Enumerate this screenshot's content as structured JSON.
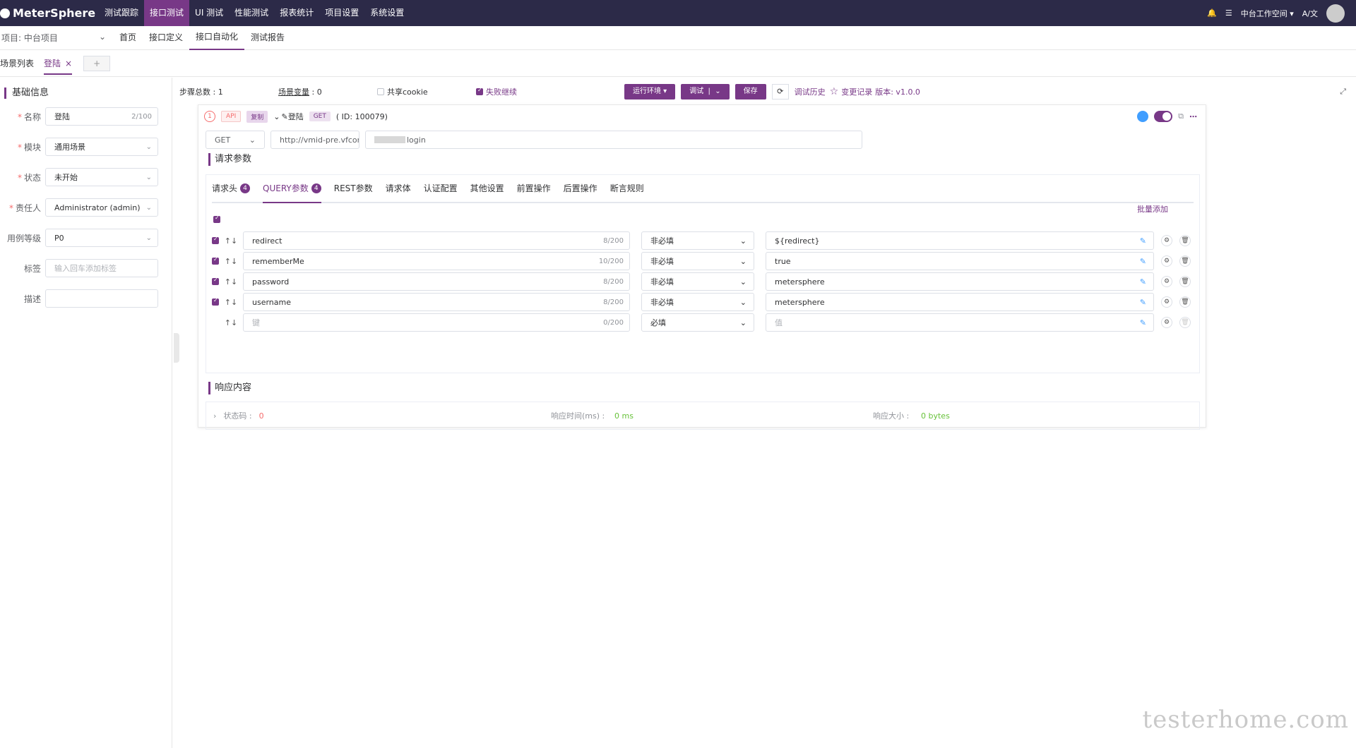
{
  "app": {
    "name": "MeterSphere"
  },
  "top_nav": {
    "items": [
      "测试跟踪",
      "接口测试",
      "UI 测试",
      "性能测试",
      "报表统计",
      "项目设置",
      "系统设置"
    ],
    "active": 1,
    "workspace": "中台工作空间",
    "lang": "A/文"
  },
  "sub_nav": {
    "project": "项目: 中台项目",
    "items": [
      "首页",
      "接口定义",
      "接口自动化",
      "测试报告"
    ],
    "active": 2
  },
  "tabs": {
    "list_label": "场景列表",
    "active_label": "登陆",
    "add_label": "+"
  },
  "basic_info": {
    "title": "基础信息",
    "name_label": "名称",
    "name_value": "登陆",
    "name_count": "2/100",
    "module_label": "模块",
    "module_value": "通用场景",
    "status_label": "状态",
    "status_value": "未开始",
    "owner_label": "责任人",
    "owner_value": "Administrator (admin)",
    "level_label": "用例等级",
    "level_value": "P0",
    "tag_label": "标签",
    "tag_placeholder": "输入回车添加标签",
    "desc_label": "描述"
  },
  "toolbar": {
    "steps_label": "步骤总数 : ",
    "steps_value": "1",
    "vars_label": "场景变量",
    "vars_value": " : 0",
    "share_cookie": "共享cookie",
    "fail_continue": "失败继续",
    "env_btn": "运行环境",
    "debug_btn": "调试",
    "save_btn": "保存",
    "history": "调试历史",
    "changes": "变更记录",
    "version": "版本: v1.0.0"
  },
  "step": {
    "index": "1",
    "type": "API",
    "copy_tag": "复制",
    "name": "登陆",
    "method_tag": "GET",
    "id": "( ID: 100079)",
    "method": "GET",
    "domain": "http://vmid-pre.vfcorp",
    "path": "login",
    "request_title": "请求参数",
    "response_title": "响应内容"
  },
  "param_tabs": [
    {
      "label": "请求头",
      "count": "4"
    },
    {
      "label": "QUERY参数",
      "count": "4"
    },
    {
      "label": "REST参数"
    },
    {
      "label": "请求体"
    },
    {
      "label": "认证配置"
    },
    {
      "label": "其他设置"
    },
    {
      "label": "前置操作"
    },
    {
      "label": "后置操作"
    },
    {
      "label": "断言规则"
    }
  ],
  "batch_add": "批量添加",
  "params": [
    {
      "key": "redirect",
      "count": "8/200",
      "required": "非必填",
      "value": "${redirect}"
    },
    {
      "key": "rememberMe",
      "count": "10/200",
      "required": "非必填",
      "value": "true"
    },
    {
      "key": "password",
      "count": "8/200",
      "required": "非必填",
      "value": "metersphere"
    },
    {
      "key": "username",
      "count": "8/200",
      "required": "非必填",
      "value": "metersphere"
    }
  ],
  "new_param": {
    "key_placeholder": "键",
    "count": "0/200",
    "required": "必填",
    "value_placeholder": "值"
  },
  "response": {
    "status_label": "状态码 :",
    "status_value": "0",
    "time_label": "响应时间(ms) :",
    "time_value": "0 ms",
    "size_label": "响应大小 :",
    "size_value": "0 bytes"
  },
  "watermark": "testerhome.com",
  "colors": {
    "brand": "#783887",
    "nav_bg": "#2c2a48",
    "danger": "#f56c6c",
    "success": "#67c23a"
  }
}
